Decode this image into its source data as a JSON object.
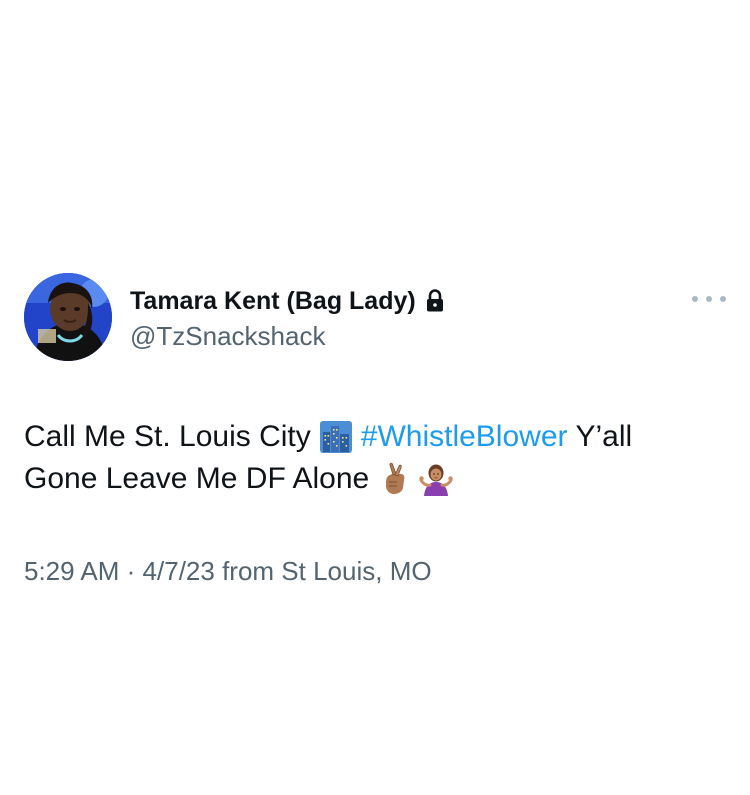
{
  "author": {
    "display_name": "Tamara Kent (Bag Lady)",
    "handle": "@TzSnackshack",
    "protected_icon": "lock-icon",
    "avatar": "profile-photo"
  },
  "tweet": {
    "text_part1": "Call Me St. Louis City",
    "emoji_city": "cityscape-emoji",
    "hashtag": "#WhistleBlower",
    "text_part2": "Y’all",
    "text_part3": "Gone Leave Me DF Alone",
    "emoji_fingers": "crossed-fingers-emoji",
    "emoji_shrug": "shrugging-woman-emoji"
  },
  "meta": {
    "time": "5:29 AM",
    "separator": "·",
    "date": "4/7/23",
    "location_text": "from St Louis, MO"
  },
  "colors": {
    "text": "#0f1419",
    "secondary": "#536471",
    "link": "#1d9bf0",
    "dots": "#aab8c2"
  },
  "menu": {
    "icon": "more-options-icon"
  }
}
